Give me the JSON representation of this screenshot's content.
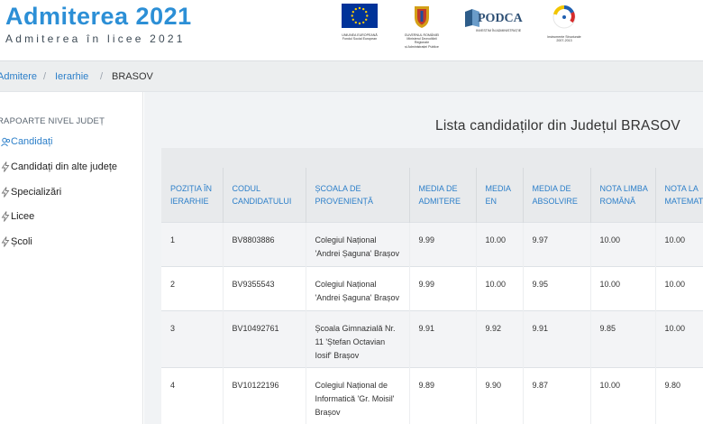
{
  "header": {
    "title": "Admiterea 2021",
    "subtitle": "Admiterea în licee 2021",
    "logos": {
      "eu_caption": [
        "UNIUNEA EUROPEANĂ",
        "Fondul Social European"
      ],
      "gov_caption": [
        "GUVERNUL ROMÂNIEI",
        "Ministerul Dezvoltării Regionale",
        "și Administrației Publice"
      ],
      "podca_text": "PODCA",
      "podca_caption": "INVESTIM ÎN ADMINISTRAȚIE",
      "is_caption": [
        "Instrumente Structurale",
        "2007-2013"
      ]
    }
  },
  "breadcrumb": {
    "items": [
      "Admitere",
      "Ierarhie",
      "BRASOV"
    ],
    "separator": "/"
  },
  "sidebar": {
    "heading": "RAPOARTE NIVEL JUDEȚ",
    "items": [
      {
        "label": "Candidați",
        "icon": "users-icon"
      },
      {
        "label": "Candidați din alte județe",
        "icon": "bolt-icon"
      },
      {
        "label": "Specializări",
        "icon": "bolt-icon"
      },
      {
        "label": "Licee",
        "icon": "bolt-icon"
      },
      {
        "label": "Școli",
        "icon": "bolt-icon"
      }
    ]
  },
  "main": {
    "list_title": "Lista candidaților din Județul BRASOV",
    "columns": [
      "POZIȚIA ÎN IERARHIE",
      "CODUL CANDIDATULUI",
      "ȘCOALA DE PROVENIENȚĂ",
      "MEDIA DE ADMITERE",
      "MEDIA EN",
      "MEDIA DE ABSOLVIRE",
      "NOTA LIMBA ROMÂNĂ",
      "NOTA LA MATEMATICĂ"
    ],
    "rows": [
      [
        "1",
        "BV8803886",
        "Colegiul Național 'Andrei Șaguna' Brașov",
        "9.99",
        "10.00",
        "9.97",
        "10.00",
        "10.00"
      ],
      [
        "2",
        "BV9355543",
        "Colegiul Național 'Andrei Șaguna' Brașov",
        "9.99",
        "10.00",
        "9.95",
        "10.00",
        "10.00"
      ],
      [
        "3",
        "BV10492761",
        "Școala Gimnazială Nr. 11 'Ștefan Octavian Iosif' Brașov",
        "9.91",
        "9.92",
        "9.91",
        "9.85",
        "10.00"
      ],
      [
        "4",
        "BV10122196",
        "Colegiul Național de Informatică 'Gr. Moisil' Brașov",
        "9.89",
        "9.90",
        "9.87",
        "10.00",
        "9.80"
      ]
    ]
  },
  "colors": {
    "brand_blue": "#2c8fd6",
    "link_blue": "#2c7fc9",
    "eu_blue": "#003399",
    "eu_star": "#ffcc00"
  }
}
